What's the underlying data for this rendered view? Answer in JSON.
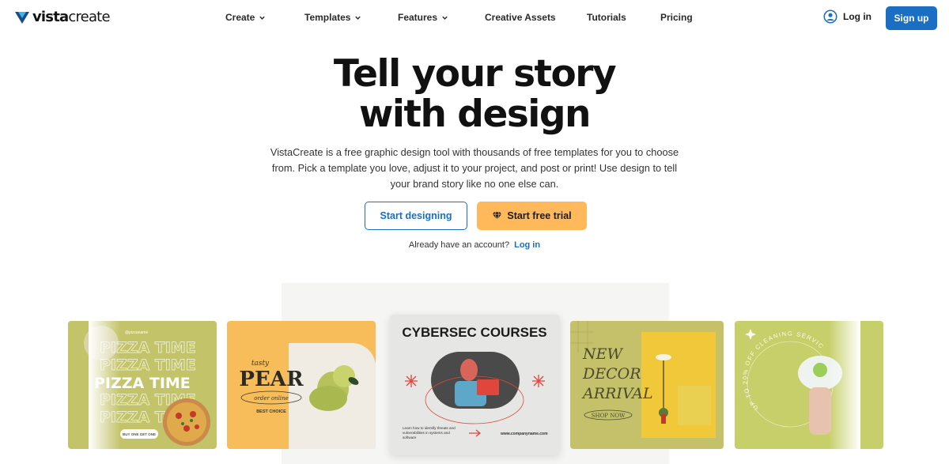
{
  "brand": {
    "name_bold": "vista",
    "name_light": "create",
    "accent": "#1a6fc4"
  },
  "nav": {
    "create": "Create",
    "templates": "Templates",
    "features": "Features",
    "creative_assets": "Creative Assets",
    "tutorials": "Tutorials",
    "pricing": "Pricing"
  },
  "header": {
    "login": "Log in",
    "signup": "Sign up"
  },
  "hero": {
    "title_line1": "Tell your story",
    "title_line2": "with design",
    "subtitle": "VistaCreate is a free graphic design tool with thousands of free templates for you to choose from. Pick a template you love, adjust it to your project, and post or print! Use design to tell your brand story like no one else can.",
    "primary_button": "Start designing",
    "trial_button": "Start free trial",
    "already_text": "Already have an account?",
    "already_link": "Log in"
  },
  "templates": {
    "pizza": {
      "handle": "@pizzaname",
      "headline": "PIZZA TIME",
      "cta": "BUY ONE GET ONE"
    },
    "pear": {
      "script": "tasty",
      "headline": "PEAR",
      "order": "order online",
      "tag": "BEST CHOICE"
    },
    "cyber": {
      "headline": "CYBERSEC COURSES",
      "body": "Learn how to identify threats and vulnerabilities in systems and software",
      "url": "www.companyname.com"
    },
    "decor": {
      "line1": "NEW",
      "line2": "DECOR",
      "line3": "ARRIVAL",
      "cta": "SHOP NOW"
    },
    "cleaning": {
      "text": "UP TO 20% OFF CLEANING SERVICE"
    }
  },
  "colors": {
    "signup_bg": "#1a6fc4",
    "trial_bg": "#ffb95a",
    "pizza_bg": "#c3c46a",
    "pear_bg": "#f7bd5a",
    "decor_bg": "#c4c16a",
    "cleaning_bg": "#c7cf6a"
  }
}
